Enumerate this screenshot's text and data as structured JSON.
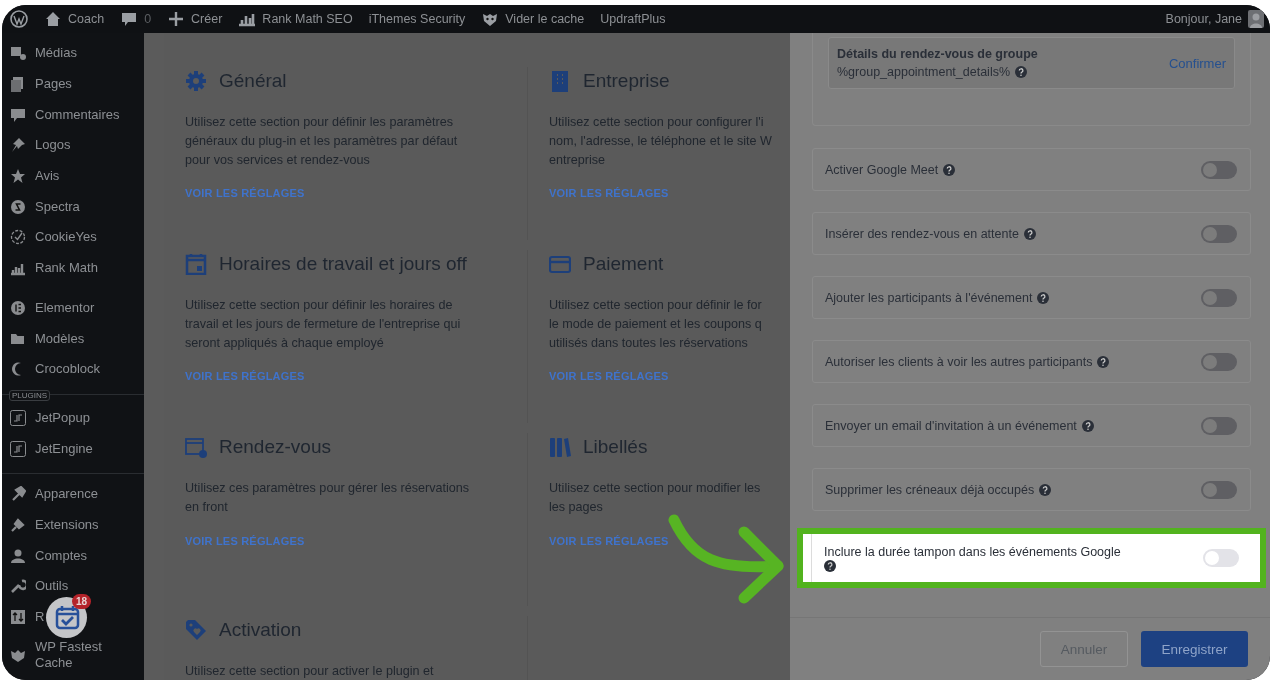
{
  "admin_bar": {
    "items": [
      {
        "kind": "logo"
      },
      {
        "kind": "home",
        "label": "Coach"
      },
      {
        "kind": "comments",
        "label": "0"
      },
      {
        "kind": "new",
        "label": "Créer"
      },
      {
        "kind": "chart",
        "label": "Rank Math SEO"
      },
      {
        "kind": "text",
        "label": "iThemes Security"
      },
      {
        "kind": "mascot",
        "label": "Vider le cache"
      },
      {
        "kind": "text",
        "label": "UpdraftPlus"
      }
    ],
    "greeting": "Bonjour, Jane"
  },
  "sidebar": {
    "groups": [
      {
        "divider": false,
        "items": [
          {
            "label": "Médias"
          },
          {
            "label": "Pages"
          },
          {
            "label": "Commentaires"
          },
          {
            "label": "Logos"
          },
          {
            "label": "Avis"
          },
          {
            "label": "Spectra"
          },
          {
            "label": "CookieYes"
          },
          {
            "label": "Rank Math"
          }
        ]
      },
      {
        "divider": false,
        "items": [
          {
            "label": "Elementor"
          },
          {
            "label": "Modèles"
          },
          {
            "label": "Crocoblock"
          }
        ]
      },
      {
        "divider": true,
        "label": "PLUGINS",
        "items": [
          {
            "label": "JetPopup"
          },
          {
            "label": "JetEngine"
          }
        ]
      },
      {
        "divider": true,
        "items": [
          {
            "label": "Apparence"
          },
          {
            "label": "Extensions"
          },
          {
            "label": "Comptes"
          },
          {
            "label": "Outils"
          },
          {
            "label": "R"
          },
          {
            "label": "WP Fastest\nCache"
          }
        ]
      }
    ]
  },
  "floating_widget": {
    "badge": "18"
  },
  "sections": [
    {
      "title": "Général",
      "description": "Utilisez cette section pour définir les paramètres\ngénéraux du plug-in et les paramètres par défaut\npour vos services et rendez-vous",
      "link": "VOIR LES RÉGLAGES"
    },
    {
      "title": "Entreprise",
      "description": "Utilisez cette section pour configurer l'i\nnom, l'adresse, le téléphone et le site W\nentreprise",
      "link": "VOIR LES RÉGLAGES"
    },
    {
      "title": "Horaires de travail et jours off",
      "description": "Utilisez cette section pour définir les horaires de\ntravail et les jours de fermeture de l'entreprise qui\nseront appliqués à chaque employé",
      "link": "VOIR LES RÉGLAGES"
    },
    {
      "title": "Paiement",
      "description": "Utilisez cette section pour définir le for\nle mode de paiement et les coupons q\nutilisés dans toutes les réservations",
      "link": "VOIR LES RÉGLAGES"
    },
    {
      "title": "Rendez-vous",
      "description": "Utilisez ces paramètres pour gérer les réservations\nen front",
      "link": "VOIR LES RÉGLAGES"
    },
    {
      "title": "Libellés",
      "description": "Utilisez cette section pour modifier les\nles pages",
      "link": "VOIR LES RÉGLAGES"
    },
    {
      "title": "Activation",
      "description": "Utilisez cette section pour activer le plugin et"
    }
  ],
  "panel": {
    "group_details": {
      "title": "Détails du rendez-vous de groupe",
      "token": "%group_appointment_details%",
      "action": "Confirmer"
    },
    "settings": [
      {
        "label": "Activer Google Meet",
        "on": false,
        "highlighted": false
      },
      {
        "label": "Insérer des rendez-vous en attente",
        "on": false,
        "highlighted": false
      },
      {
        "label": "Ajouter les participants à l'événement",
        "on": false,
        "highlighted": false
      },
      {
        "label": "Autoriser les clients à voir les autres participants",
        "on": false,
        "highlighted": false
      },
      {
        "label": "Envoyer un email d'invitation à un événement",
        "on": false,
        "highlighted": false
      },
      {
        "label": "Supprimer les créneaux déjà occupés",
        "on": false,
        "highlighted": false
      },
      {
        "label": "Inclure la durée tampon dans les événements Google",
        "on": false,
        "highlighted": true
      }
    ],
    "buttons": [
      {
        "label": "Annuler",
        "kind": "secondary"
      },
      {
        "label": "Enregistrer",
        "kind": "primary"
      }
    ]
  }
}
